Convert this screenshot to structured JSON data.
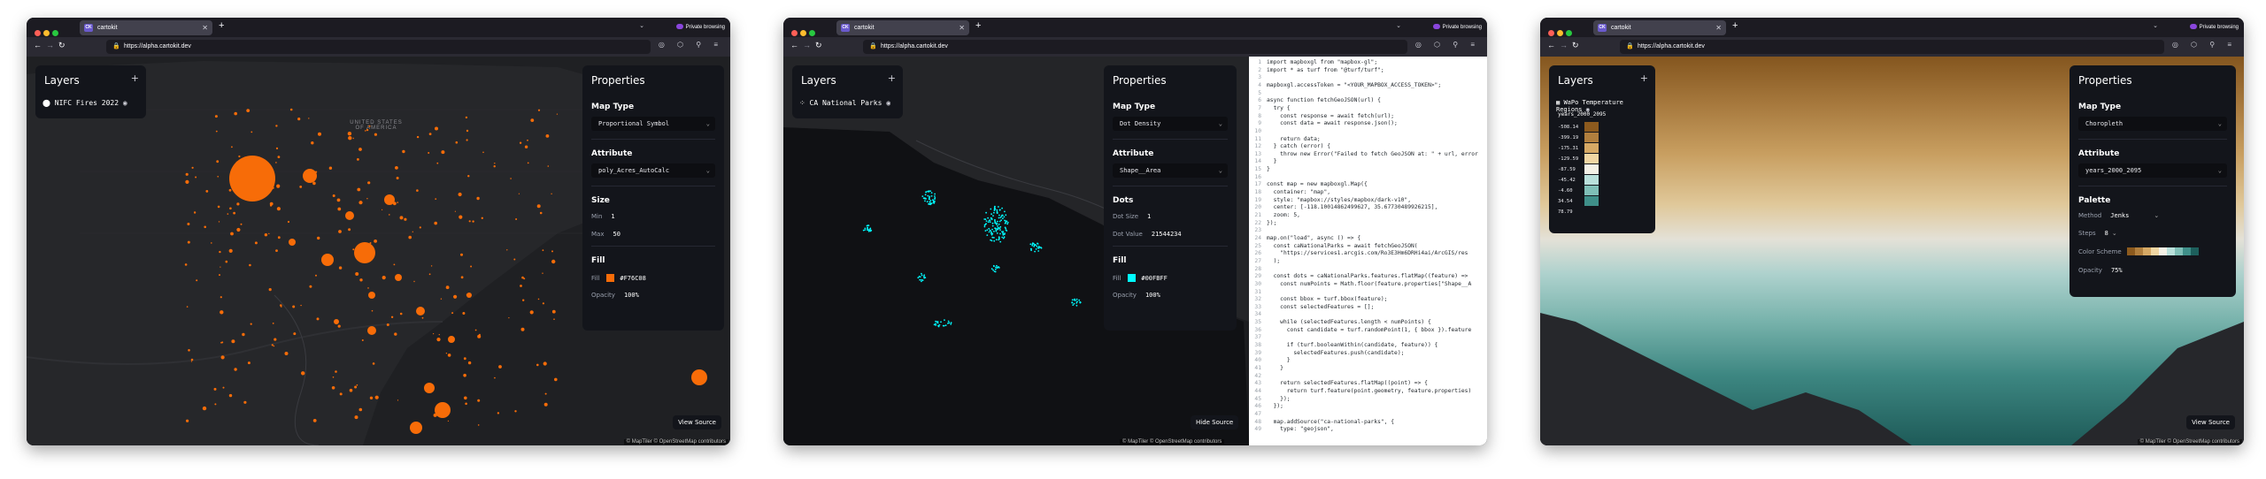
{
  "windows": [
    {
      "tab_title": "cartokit",
      "tab_favicon": "CK",
      "private_label": "Private browsing",
      "url": "https://alpha.cartokit.dev",
      "layers_title": "Layers",
      "layer_name": "NIFC Fires 2022",
      "properties_title": "Properties",
      "map_type_label": "Map Type",
      "map_type_value": "Proportional Symbol",
      "attribute_label": "Attribute",
      "attribute_value": "poly_Acres_AutoCalc",
      "size_label": "Size",
      "min_label": "Min",
      "min_value": "1",
      "max_label": "Max",
      "max_value": "50",
      "fill_label": "Fill",
      "fill_field_label": "Fill",
      "fill_color": "#F76C08",
      "opacity_label": "Opacity",
      "opacity_value": "100%",
      "view_source": "View Source",
      "place_label": "UNITED STATES OF AMERICA",
      "attribution": "© MapTiler © OpenStreetMap contributors"
    },
    {
      "tab_title": "cartokit",
      "tab_favicon": "CK",
      "private_label": "Private browsing",
      "url": "https://alpha.cartokit.dev",
      "layers_title": "Layers",
      "layer_name": "CA National Parks",
      "properties_title": "Properties",
      "map_type_label": "Map Type",
      "map_type_value": "Dot Density",
      "attribute_label": "Attribute",
      "attribute_value": "Shape__Area",
      "dots_label": "Dots",
      "dot_size_label": "Dot Size",
      "dot_size_value": "1",
      "dot_value_label": "Dot Value",
      "dot_value_value": "21544234",
      "fill_label": "Fill",
      "fill_field_label": "Fill",
      "fill_color": "#00FBFF",
      "opacity_label": "Opacity",
      "opacity_value": "100%",
      "hide_source": "Hide Source",
      "attribution": "© MapTiler © OpenStreetMap contributors",
      "code_lines": [
        "import mapboxgl from \"mapbox-gl\";",
        "import * as turf from \"@turf/turf\";",
        "",
        "mapboxgl.accessToken = \"<YOUR_MAPBOX_ACCESS_TOKEN>\";",
        "",
        "async function fetchGeoJSON(url) {",
        "  try {",
        "    const response = await fetch(url);",
        "    const data = await response.json();",
        "",
        "    return data;",
        "  } catch (error) {",
        "    throw new Error(\"Failed to fetch GeoJSON at: \" + url, error",
        "  }",
        "}",
        "",
        "const map = new mapboxgl.Map({",
        "  container: \"map\",",
        "  style: \"mapbox://styles/mapbox/dark-v10\",",
        "  center: [-118.10014862499627, 35.67730489926215],",
        "  zoom: 5,",
        "});",
        "",
        "map.on(\"load\", async () => {",
        "  const caNationalParks = await fetchGeoJSON(",
        "    \"https://services1.arcgis.com/Ro3E3Hm6DRHi4ai/ArcGIS/res",
        "  );",
        "",
        "  const dots = caNationalParks.features.flatMap((feature) =>",
        "    const numPoints = Math.floor(feature.properties[\"Shape__A",
        "",
        "    const bbox = turf.bbox(feature);",
        "    const selectedFeatures = [];",
        "",
        "    while (selectedFeatures.length < numPoints) {",
        "      const candidate = turf.randomPoint(1, { bbox }).feature",
        "",
        "      if (turf.booleanWithin(candidate, feature)) {",
        "        selectedFeatures.push(candidate);",
        "      }",
        "    }",
        "",
        "    return selectedFeatures.flatMap((point) => {",
        "      return turf.feature(point.geometry, feature.properties)",
        "    });",
        "  });",
        "",
        "  map.addSource(\"ca-national-parks\", {",
        "    type: \"geojson\","
      ]
    },
    {
      "tab_title": "cartokit",
      "tab_favicon": "CK",
      "private_label": "Private browsing",
      "url": "https://alpha.cartokit.dev",
      "layers_title": "Layers",
      "layer_name": "WaPo Temperature Regions",
      "legend_title": "years_2000_2095",
      "legend_breaks": [
        "-508.14",
        "-399.19",
        "-175.31",
        "-129.59",
        "-87.59",
        "-45.42",
        "-4.60",
        "34.54",
        "78.79"
      ],
      "legend_colors": [
        "#8c5a1e",
        "#b17f3e",
        "#d6a965",
        "#f0d6a3",
        "#f4f1e6",
        "#b9e0db",
        "#7fbfb7",
        "#3f8f89",
        "#1d5f5c"
      ],
      "properties_title": "Properties",
      "map_type_label": "Map Type",
      "map_type_value": "Choropleth",
      "attribute_label": "Attribute",
      "attribute_value": "years_2000_2095",
      "palette_label": "Palette",
      "method_label": "Method",
      "method_value": "Jenks",
      "steps_label": "Steps",
      "steps_value": "8",
      "color_scheme_label": "Color Scheme",
      "opacity_label": "Opacity",
      "opacity_value": "75%",
      "view_source": "View Source",
      "attribution": "© MapTiler © OpenStreetMap contributors"
    }
  ],
  "colors": {
    "accent": "#F76C08",
    "dots": "#00FBFF",
    "panel": "#13151b"
  }
}
